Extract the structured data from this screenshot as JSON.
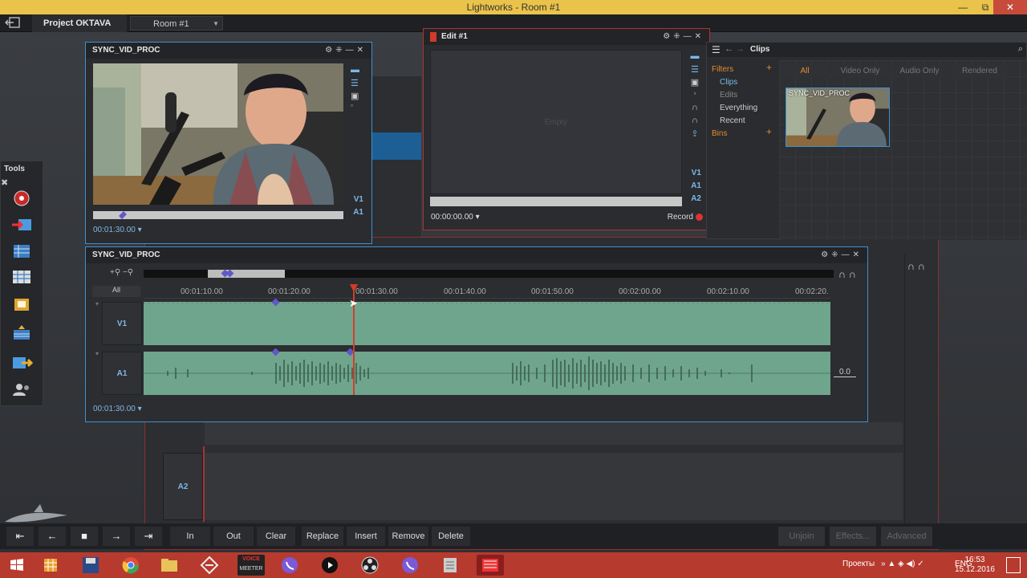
{
  "os": {
    "title": "Lightworks - Room #1",
    "min": "—",
    "max": "⧉",
    "close": "✕"
  },
  "appbar": {
    "exit_icon": "exit-icon",
    "project": "Project OKTAVA",
    "room": "Room #1"
  },
  "tools": {
    "title": "Tools"
  },
  "source_viewer": {
    "title": "SYNC_VID_PROC",
    "timecode": "00:01:30.00",
    "tracks": [
      "V1",
      "A1"
    ]
  },
  "edit_viewer": {
    "title": "Edit #1",
    "empty_text": "Empty",
    "timecode": "00:00:00.00",
    "record": "Record",
    "tracks": [
      "V1",
      "A1",
      "A2"
    ]
  },
  "clips": {
    "title": "Clips",
    "filters": "Filters",
    "bins": "Bins",
    "filter_items": [
      "Clips",
      "Edits",
      "Everything",
      "Recent"
    ],
    "tabs": [
      "All",
      "Video Only",
      "Audio Only",
      "Rendered"
    ],
    "thumb_caption": "SYNC_VID_PROC"
  },
  "timeline": {
    "title": "SYNC_VID_PROC",
    "all": "All",
    "ticks": [
      "00:01:10.00",
      "00:01:20.00",
      "00:01:30.00",
      "00:01:40.00",
      "00:01:50.00",
      "00:02:00.00",
      "00:02:10.00",
      "00:02:20."
    ],
    "tracks": [
      "V1",
      "A1"
    ],
    "timecode": "00:01:30.00",
    "gain": "0.0"
  },
  "bg_timeline": {
    "track": "A2"
  },
  "bottombar": {
    "buttons": [
      "In",
      "Out",
      "Clear",
      "Replace",
      "Insert",
      "Remove",
      "Delete"
    ],
    "right_buttons": [
      "Unjoin",
      "Effects...",
      "Advanced"
    ]
  },
  "taskbar": {
    "tray_label": "Проекты",
    "lang": "ENG",
    "time": "16:53",
    "date": "15.12.2016",
    "voicemeeter_line1": "VOICE",
    "voicemeeter_line2": "MEETER"
  },
  "colors": {
    "accent_blue": "#3f8fd0",
    "accent_red": "#b03232",
    "lane": "#6fa58d",
    "orange": "#e58a2e"
  }
}
